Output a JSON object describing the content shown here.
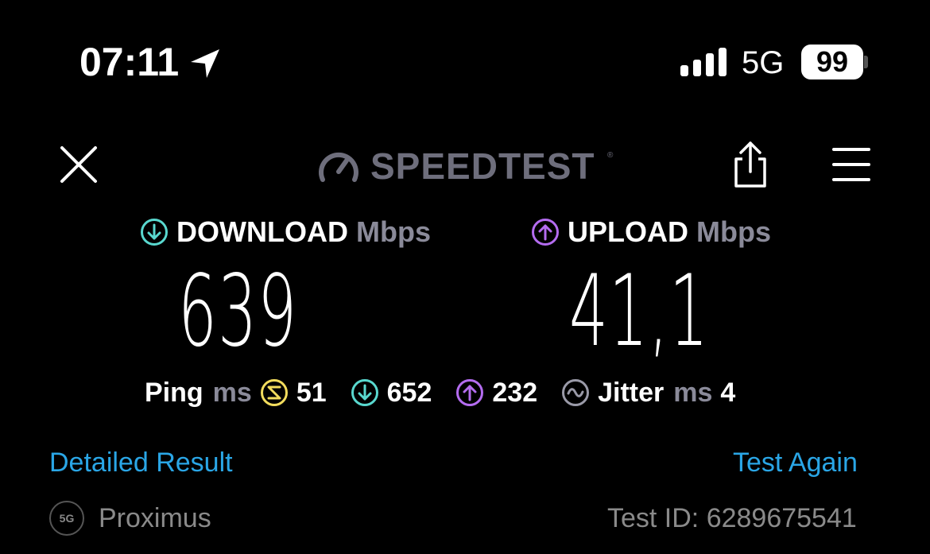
{
  "status_bar": {
    "time": "07:11",
    "network": "5G",
    "battery": "99"
  },
  "header": {
    "brand": "SPEEDTEST",
    "brand_mark": "®"
  },
  "download": {
    "label": "DOWNLOAD",
    "unit": "Mbps",
    "value": "639",
    "color": "#59d8cf"
  },
  "upload": {
    "label": "UPLOAD",
    "unit": "Mbps",
    "value": "41,1",
    "color": "#b46cf0"
  },
  "ping": {
    "label": "Ping",
    "unit": "ms",
    "idle": "51",
    "download": "652",
    "upload": "232",
    "idle_color": "#f2dc5d"
  },
  "jitter": {
    "label": "Jitter",
    "unit": "ms",
    "value": "4"
  },
  "links": {
    "detailed": "Detailed Result",
    "again": "Test Again"
  },
  "footer": {
    "network_badge": "5G",
    "provider": "Proximus",
    "test_id": "Test ID: 6289675541"
  },
  "icons": [
    "location-arrow-icon",
    "signal-bars-icon",
    "close-icon",
    "speedometer-icon",
    "share-icon",
    "menu-icon",
    "download-icon",
    "upload-icon",
    "ping-idle-icon",
    "jitter-icon"
  ]
}
